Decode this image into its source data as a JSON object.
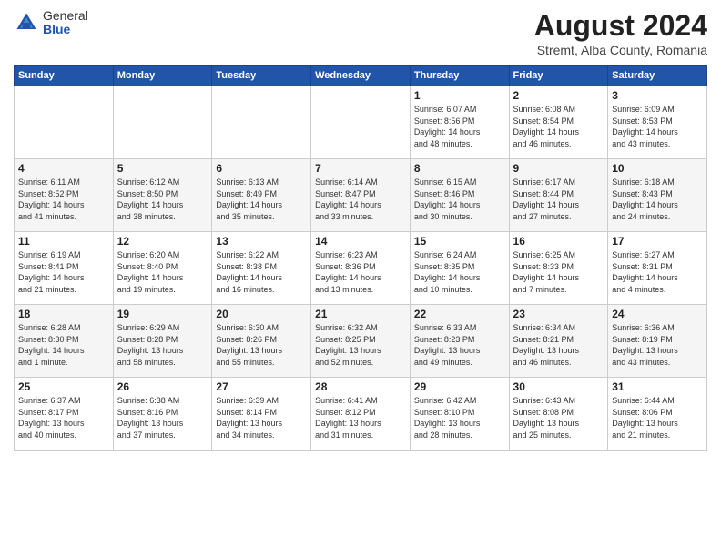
{
  "logo": {
    "general": "General",
    "blue": "Blue"
  },
  "title": "August 2024",
  "subtitle": "Stremt, Alba County, Romania",
  "days_of_week": [
    "Sunday",
    "Monday",
    "Tuesday",
    "Wednesday",
    "Thursday",
    "Friday",
    "Saturday"
  ],
  "weeks": [
    [
      {
        "day": "",
        "info": ""
      },
      {
        "day": "",
        "info": ""
      },
      {
        "day": "",
        "info": ""
      },
      {
        "day": "",
        "info": ""
      },
      {
        "day": "1",
        "info": "Sunrise: 6:07 AM\nSunset: 8:56 PM\nDaylight: 14 hours\nand 48 minutes."
      },
      {
        "day": "2",
        "info": "Sunrise: 6:08 AM\nSunset: 8:54 PM\nDaylight: 14 hours\nand 46 minutes."
      },
      {
        "day": "3",
        "info": "Sunrise: 6:09 AM\nSunset: 8:53 PM\nDaylight: 14 hours\nand 43 minutes."
      }
    ],
    [
      {
        "day": "4",
        "info": "Sunrise: 6:11 AM\nSunset: 8:52 PM\nDaylight: 14 hours\nand 41 minutes."
      },
      {
        "day": "5",
        "info": "Sunrise: 6:12 AM\nSunset: 8:50 PM\nDaylight: 14 hours\nand 38 minutes."
      },
      {
        "day": "6",
        "info": "Sunrise: 6:13 AM\nSunset: 8:49 PM\nDaylight: 14 hours\nand 35 minutes."
      },
      {
        "day": "7",
        "info": "Sunrise: 6:14 AM\nSunset: 8:47 PM\nDaylight: 14 hours\nand 33 minutes."
      },
      {
        "day": "8",
        "info": "Sunrise: 6:15 AM\nSunset: 8:46 PM\nDaylight: 14 hours\nand 30 minutes."
      },
      {
        "day": "9",
        "info": "Sunrise: 6:17 AM\nSunset: 8:44 PM\nDaylight: 14 hours\nand 27 minutes."
      },
      {
        "day": "10",
        "info": "Sunrise: 6:18 AM\nSunset: 8:43 PM\nDaylight: 14 hours\nand 24 minutes."
      }
    ],
    [
      {
        "day": "11",
        "info": "Sunrise: 6:19 AM\nSunset: 8:41 PM\nDaylight: 14 hours\nand 21 minutes."
      },
      {
        "day": "12",
        "info": "Sunrise: 6:20 AM\nSunset: 8:40 PM\nDaylight: 14 hours\nand 19 minutes."
      },
      {
        "day": "13",
        "info": "Sunrise: 6:22 AM\nSunset: 8:38 PM\nDaylight: 14 hours\nand 16 minutes."
      },
      {
        "day": "14",
        "info": "Sunrise: 6:23 AM\nSunset: 8:36 PM\nDaylight: 14 hours\nand 13 minutes."
      },
      {
        "day": "15",
        "info": "Sunrise: 6:24 AM\nSunset: 8:35 PM\nDaylight: 14 hours\nand 10 minutes."
      },
      {
        "day": "16",
        "info": "Sunrise: 6:25 AM\nSunset: 8:33 PM\nDaylight: 14 hours\nand 7 minutes."
      },
      {
        "day": "17",
        "info": "Sunrise: 6:27 AM\nSunset: 8:31 PM\nDaylight: 14 hours\nand 4 minutes."
      }
    ],
    [
      {
        "day": "18",
        "info": "Sunrise: 6:28 AM\nSunset: 8:30 PM\nDaylight: 14 hours\nand 1 minute."
      },
      {
        "day": "19",
        "info": "Sunrise: 6:29 AM\nSunset: 8:28 PM\nDaylight: 13 hours\nand 58 minutes."
      },
      {
        "day": "20",
        "info": "Sunrise: 6:30 AM\nSunset: 8:26 PM\nDaylight: 13 hours\nand 55 minutes."
      },
      {
        "day": "21",
        "info": "Sunrise: 6:32 AM\nSunset: 8:25 PM\nDaylight: 13 hours\nand 52 minutes."
      },
      {
        "day": "22",
        "info": "Sunrise: 6:33 AM\nSunset: 8:23 PM\nDaylight: 13 hours\nand 49 minutes."
      },
      {
        "day": "23",
        "info": "Sunrise: 6:34 AM\nSunset: 8:21 PM\nDaylight: 13 hours\nand 46 minutes."
      },
      {
        "day": "24",
        "info": "Sunrise: 6:36 AM\nSunset: 8:19 PM\nDaylight: 13 hours\nand 43 minutes."
      }
    ],
    [
      {
        "day": "25",
        "info": "Sunrise: 6:37 AM\nSunset: 8:17 PM\nDaylight: 13 hours\nand 40 minutes."
      },
      {
        "day": "26",
        "info": "Sunrise: 6:38 AM\nSunset: 8:16 PM\nDaylight: 13 hours\nand 37 minutes."
      },
      {
        "day": "27",
        "info": "Sunrise: 6:39 AM\nSunset: 8:14 PM\nDaylight: 13 hours\nand 34 minutes."
      },
      {
        "day": "28",
        "info": "Sunrise: 6:41 AM\nSunset: 8:12 PM\nDaylight: 13 hours\nand 31 minutes."
      },
      {
        "day": "29",
        "info": "Sunrise: 6:42 AM\nSunset: 8:10 PM\nDaylight: 13 hours\nand 28 minutes."
      },
      {
        "day": "30",
        "info": "Sunrise: 6:43 AM\nSunset: 8:08 PM\nDaylight: 13 hours\nand 25 minutes."
      },
      {
        "day": "31",
        "info": "Sunrise: 6:44 AM\nSunset: 8:06 PM\nDaylight: 13 hours\nand 21 minutes."
      }
    ]
  ]
}
